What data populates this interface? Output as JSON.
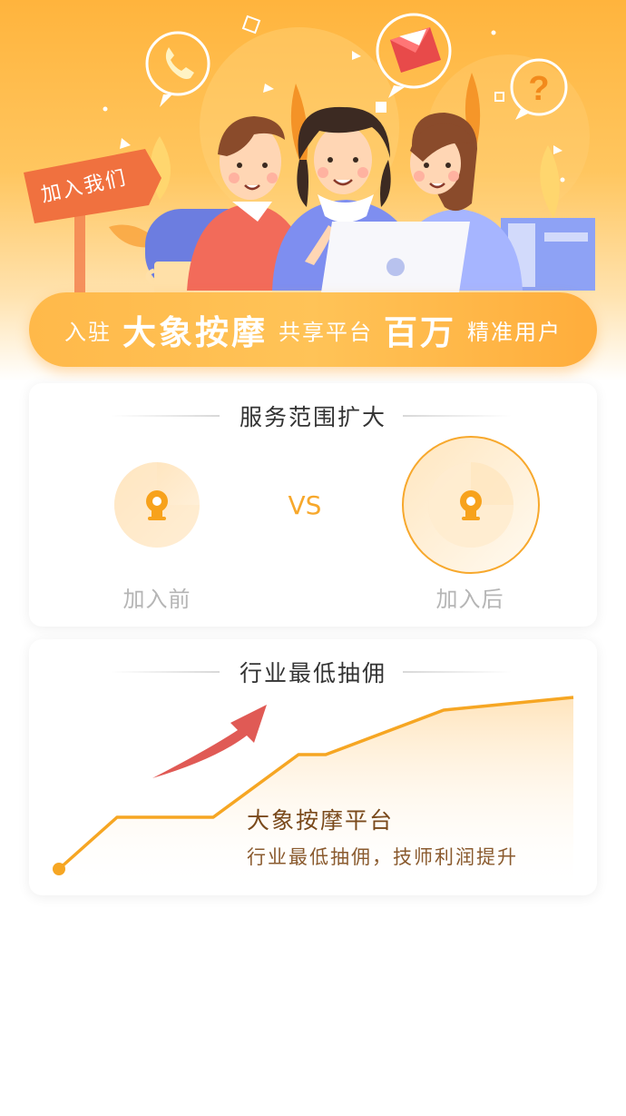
{
  "hero": {
    "sign_text": "加入我们",
    "banner": {
      "part1": "入驻",
      "brand": "大象按摩",
      "part2": "共享平台",
      "highlight": "百万",
      "part3": "精准用户"
    },
    "icons": [
      "phone-icon",
      "mail-icon",
      "question-icon"
    ]
  },
  "service_card": {
    "title": "服务范围扩大",
    "vs": "VS",
    "before_label": "加入前",
    "after_label": "加入后",
    "icons": [
      "location-pin-icon"
    ]
  },
  "commission_card": {
    "title": "行业最低抽佣",
    "chart_title": "大象按摩平台",
    "chart_subtitle": "行业最低抽佣，技师利润提升"
  },
  "colors": {
    "accent": "#f7a82c",
    "hero_top": "#ffb43d",
    "arrow": "#e05a55"
  }
}
